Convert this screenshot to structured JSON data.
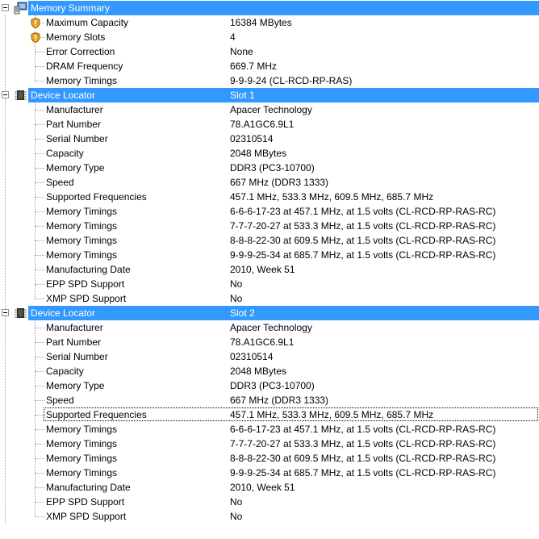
{
  "sections": [
    {
      "header": {
        "label": "Memory Summary",
        "value": "",
        "icon": "computer-memory-icon"
      },
      "items": [
        {
          "label": "Maximum Capacity",
          "value": "16384 MBytes",
          "icon": "shield-warning-icon"
        },
        {
          "label": "Memory Slots",
          "value": "4",
          "icon": "shield-warning-icon"
        },
        {
          "label": "Error Correction",
          "value": "None"
        },
        {
          "label": "DRAM Frequency",
          "value": "669.7 MHz"
        },
        {
          "label": "Memory Timings",
          "value": "9-9-9-24 (CL-RCD-RP-RAS)"
        }
      ]
    },
    {
      "header": {
        "label": "Device Locator",
        "value": "Slot 1",
        "icon": "memory-chip-icon"
      },
      "items": [
        {
          "label": "Manufacturer",
          "value": "Apacer Technology"
        },
        {
          "label": "Part Number",
          "value": "78.A1GC6.9L1"
        },
        {
          "label": "Serial Number",
          "value": "02310514"
        },
        {
          "label": "Capacity",
          "value": "2048 MBytes"
        },
        {
          "label": "Memory Type",
          "value": "DDR3 (PC3-10700)"
        },
        {
          "label": "Speed",
          "value": "667 MHz (DDR3 1333)"
        },
        {
          "label": "Supported Frequencies",
          "value": "457.1 MHz, 533.3 MHz, 609.5 MHz, 685.7 MHz"
        },
        {
          "label": "Memory Timings",
          "value": "6-6-6-17-23 at 457.1 MHz, at 1.5 volts (CL-RCD-RP-RAS-RC)"
        },
        {
          "label": "Memory Timings",
          "value": "7-7-7-20-27 at 533.3 MHz, at 1.5 volts (CL-RCD-RP-RAS-RC)"
        },
        {
          "label": "Memory Timings",
          "value": "8-8-8-22-30 at 609.5 MHz, at 1.5 volts (CL-RCD-RP-RAS-RC)"
        },
        {
          "label": "Memory Timings",
          "value": "9-9-9-25-34 at 685.7 MHz, at 1.5 volts (CL-RCD-RP-RAS-RC)"
        },
        {
          "label": "Manufacturing Date",
          "value": "2010, Week 51"
        },
        {
          "label": "EPP SPD Support",
          "value": "No"
        },
        {
          "label": "XMP SPD Support",
          "value": "No"
        }
      ]
    },
    {
      "header": {
        "label": "Device Locator",
        "value": "Slot 2",
        "icon": "memory-chip-icon"
      },
      "items": [
        {
          "label": "Manufacturer",
          "value": "Apacer Technology"
        },
        {
          "label": "Part Number",
          "value": "78.A1GC6.9L1"
        },
        {
          "label": "Serial Number",
          "value": "02310514"
        },
        {
          "label": "Capacity",
          "value": "2048 MBytes"
        },
        {
          "label": "Memory Type",
          "value": "DDR3 (PC3-10700)"
        },
        {
          "label": "Speed",
          "value": "667 MHz (DDR3 1333)"
        },
        {
          "label": "Supported Frequencies",
          "value": "457.1 MHz, 533.3 MHz, 609.5 MHz, 685.7 MHz",
          "focused": true
        },
        {
          "label": "Memory Timings",
          "value": "6-6-6-17-23 at 457.1 MHz, at 1.5 volts (CL-RCD-RP-RAS-RC)"
        },
        {
          "label": "Memory Timings",
          "value": "7-7-7-20-27 at 533.3 MHz, at 1.5 volts (CL-RCD-RP-RAS-RC)"
        },
        {
          "label": "Memory Timings",
          "value": "8-8-8-22-30 at 609.5 MHz, at 1.5 volts (CL-RCD-RP-RAS-RC)"
        },
        {
          "label": "Memory Timings",
          "value": "9-9-9-25-34 at 685.7 MHz, at 1.5 volts (CL-RCD-RP-RAS-RC)"
        },
        {
          "label": "Manufacturing Date",
          "value": "2010, Week 51"
        },
        {
          "label": "EPP SPD Support",
          "value": "No"
        },
        {
          "label": "XMP SPD Support",
          "value": "No"
        }
      ]
    }
  ],
  "colors": {
    "selection": "#3399ff",
    "tree_lines": "#a0a0a0"
  }
}
